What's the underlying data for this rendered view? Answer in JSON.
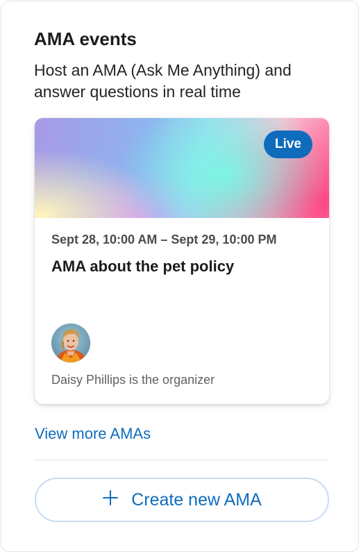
{
  "header": {
    "title": "AMA events",
    "subtitle": "Host an AMA (Ask Me Anything) and answer questions in real time"
  },
  "event_card": {
    "badge": "Live",
    "date_range": "Sept 28, 10:00 AM – Sept 29, 10:00 PM",
    "title": "AMA about the pet policy",
    "organizer_text": "Daisy Phillips is the organizer",
    "avatar_icon": "organizer-avatar"
  },
  "links": {
    "view_more": "View more AMAs"
  },
  "actions": {
    "create_label": "Create new AMA",
    "create_icon": "plus-icon"
  },
  "colors": {
    "accent": "#0f6cbd",
    "text_primary": "#1b1b1b",
    "text_secondary": "#616161"
  }
}
